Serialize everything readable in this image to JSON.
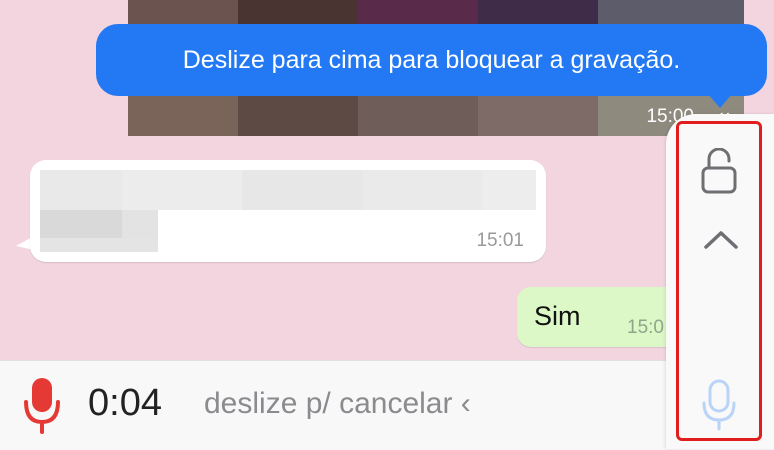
{
  "chat": {
    "video_message": {
      "time": "15:00",
      "status": "‹‹"
    },
    "incoming_message": {
      "time": "15:01"
    },
    "outgoing_message": {
      "text": "Sim",
      "time": "15:0"
    }
  },
  "tooltip": {
    "text": "Deslize para cima para bloquear a gravação."
  },
  "recording": {
    "timer": "0:04",
    "cancel_hint": "deslize p/ cancelar ‹"
  },
  "lock_panel": {
    "lock_icon": "unlocked-padlock-icon",
    "arrow_icon": "chevron-up-icon",
    "mic_icon": "microphone-icon"
  },
  "colors": {
    "background": "#f2d5df",
    "tooltip": "#2379f3",
    "outgoing_bubble": "#dcf8c6",
    "mic_recording": "#e53935",
    "highlight": "#e01e1e",
    "mic_locked": "#b9d4f7"
  }
}
